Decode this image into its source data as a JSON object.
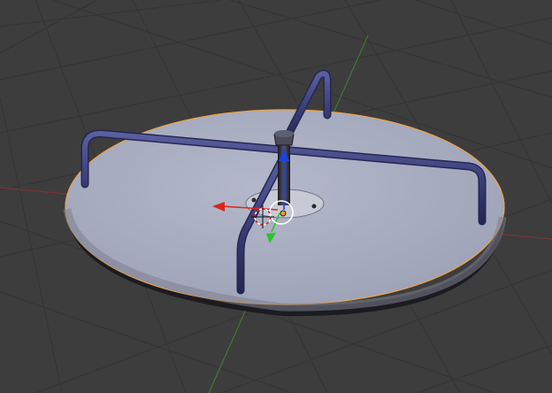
{
  "app": "3D Viewport",
  "viewport": {
    "background": "#3d3d3d",
    "grid_color": "#353535",
    "x_axis_color": "#7a3434",
    "y_axis_color": "#3f7a2e"
  },
  "object": {
    "name": "merry-go-round",
    "selected": true,
    "selection_outline": "#e8a34a",
    "platform_color": "#a9adc1",
    "platform_edge_color": "#7d8090",
    "rail_color": "#3b3f7a"
  },
  "gizmo": {
    "x_color": "#e0241b",
    "y_color": "#2bc42b",
    "z_color": "#1f3fe0"
  }
}
